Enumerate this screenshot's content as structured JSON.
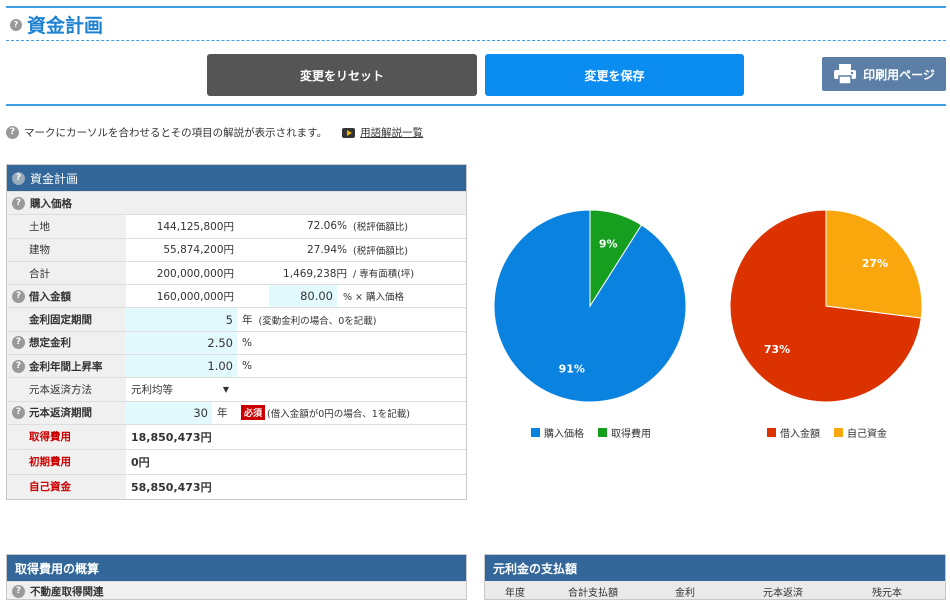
{
  "header": {
    "title": "資金計画"
  },
  "toolbar": {
    "reset_label": "変更をリセット",
    "save_label": "変更を保存",
    "print_label": "印刷用ページ"
  },
  "hint": {
    "text": "マークにカーソルを合わせるとその項目の解説が表示されます。",
    "glossary_link": "用語解説一覧"
  },
  "plan": {
    "title": "資金計画",
    "purchase_section": "購入価格",
    "land": {
      "label": "土地",
      "amount": "144,125,800円",
      "pct": "72.06%",
      "note": "(税評価額比)"
    },
    "building": {
      "label": "建物",
      "amount": "55,874,200円",
      "pct": "27.94%",
      "note": "(税評価額比)"
    },
    "total": {
      "label": "合計",
      "amount": "200,000,000円",
      "per_tsubo": "1,469,238円",
      "note": "/ 専有面積(坪)"
    },
    "loan": {
      "label": "借入金額",
      "amount": "160,000,000円",
      "pct_value": "80.00",
      "note": "% × 購入価格"
    },
    "fixed_period": {
      "label": "金利固定期間",
      "value": "5",
      "unit": "年",
      "note": "(変動金利の場合、0を記載)"
    },
    "rate": {
      "label": "想定金利",
      "value": "2.50",
      "unit": "%"
    },
    "rate_increase": {
      "label": "金利年間上昇率",
      "value": "1.00",
      "unit": "%"
    },
    "repay_method": {
      "label": "元本返済方法",
      "value": "元利均等"
    },
    "repay_period": {
      "label": "元本返済期間",
      "value": "30",
      "unit": "年",
      "required": "必須",
      "note": "(借入金額が0円の場合、1を記載)"
    },
    "acq_cost": {
      "label": "取得費用",
      "value": "18,850,473円"
    },
    "initial_cost": {
      "label": "初期費用",
      "value": "0円"
    },
    "own_funds": {
      "label": "自己資金",
      "value": "58,850,473円"
    }
  },
  "chart_data": [
    {
      "type": "pie",
      "categories": [
        "購入価格",
        "取得費用"
      ],
      "values": [
        91,
        9
      ],
      "data_labels": [
        "91%",
        "9%"
      ],
      "colors": [
        "#0a82e0",
        "#169f1e"
      ],
      "legend_position": "bottom"
    },
    {
      "type": "pie",
      "categories": [
        "借入金額",
        "自己資金"
      ],
      "values": [
        73,
        27
      ],
      "data_labels": [
        "73%",
        "27%"
      ],
      "colors": [
        "#dc3200",
        "#f9a70d"
      ],
      "legend_position": "bottom"
    }
  ],
  "acq_panel": {
    "title": "取得費用の概算",
    "first_row": "不動産取得関連"
  },
  "pay_panel": {
    "title": "元利金の支払額",
    "columns": [
      "年度",
      "合計支払額",
      "金利",
      "元本返済",
      "残元本"
    ]
  }
}
